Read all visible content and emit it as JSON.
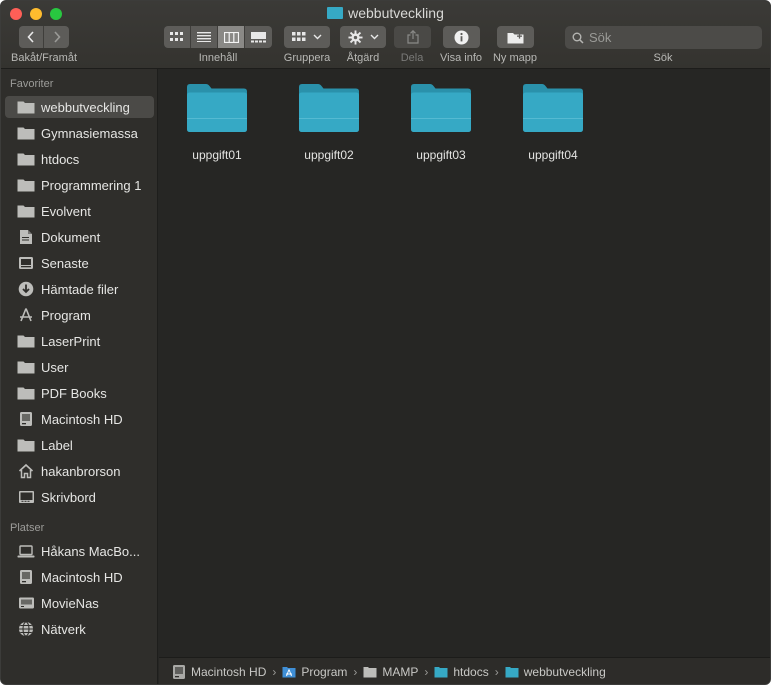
{
  "window": {
    "title": "webbutveckling"
  },
  "toolbar": {
    "back_forward_label": "Bakåt/Framåt",
    "view_label": "Innehåll",
    "group_label": "Gruppera",
    "action_label": "Åtgärd",
    "share_label": "Dela",
    "info_label": "Visa info",
    "new_folder_label": "Ny mapp",
    "search_label": "Sök",
    "search_placeholder": "Sök"
  },
  "sidebar": {
    "favorites_header": "Favoriter",
    "favorites": [
      {
        "label": "webbutveckling",
        "icon": "folder-icon",
        "selected": true
      },
      {
        "label": "Gymnasiemassa",
        "icon": "folder-icon"
      },
      {
        "label": "htdocs",
        "icon": "folder-icon"
      },
      {
        "label": "Programmering 1",
        "icon": "folder-icon"
      },
      {
        "label": "Evolvent",
        "icon": "folder-icon"
      },
      {
        "label": "Dokument",
        "icon": "document-icon"
      },
      {
        "label": "Senaste",
        "icon": "recents-icon"
      },
      {
        "label": "Hämtade filer",
        "icon": "download-icon"
      },
      {
        "label": "Program",
        "icon": "applications-icon"
      },
      {
        "label": "LaserPrint",
        "icon": "folder-icon"
      },
      {
        "label": "User",
        "icon": "folder-icon"
      },
      {
        "label": "PDF Books",
        "icon": "folder-icon"
      },
      {
        "label": "Macintosh HD",
        "icon": "hard-drive-icon"
      },
      {
        "label": "Label",
        "icon": "folder-icon"
      },
      {
        "label": "hakanbrorson",
        "icon": "home-icon"
      },
      {
        "label": "Skrivbord",
        "icon": "desktop-icon"
      }
    ],
    "locations_header": "Platser",
    "locations": [
      {
        "label": "Håkans MacBo...",
        "icon": "laptop-icon"
      },
      {
        "label": "Macintosh HD",
        "icon": "hard-drive-icon"
      },
      {
        "label": "MovieNas",
        "icon": "network-drive-icon"
      },
      {
        "label": "Nätverk",
        "icon": "network-icon"
      }
    ]
  },
  "main": {
    "items": [
      {
        "name": "uppgift01"
      },
      {
        "name": "uppgift02"
      },
      {
        "name": "uppgift03"
      },
      {
        "name": "uppgift04"
      }
    ]
  },
  "pathbar": {
    "crumbs": [
      {
        "label": "Macintosh HD",
        "icon": "hard-drive-icon"
      },
      {
        "label": "Program",
        "icon": "applications-folder-icon"
      },
      {
        "label": "MAMP",
        "icon": "folder-icon"
      },
      {
        "label": "htdocs",
        "icon": "folder-icon"
      },
      {
        "label": "webbutveckling",
        "icon": "folder-icon"
      }
    ]
  },
  "colors": {
    "folder": "#36a9c5",
    "folder_dark": "#2a91ab",
    "sidebar_icon": "#bdbdba"
  }
}
